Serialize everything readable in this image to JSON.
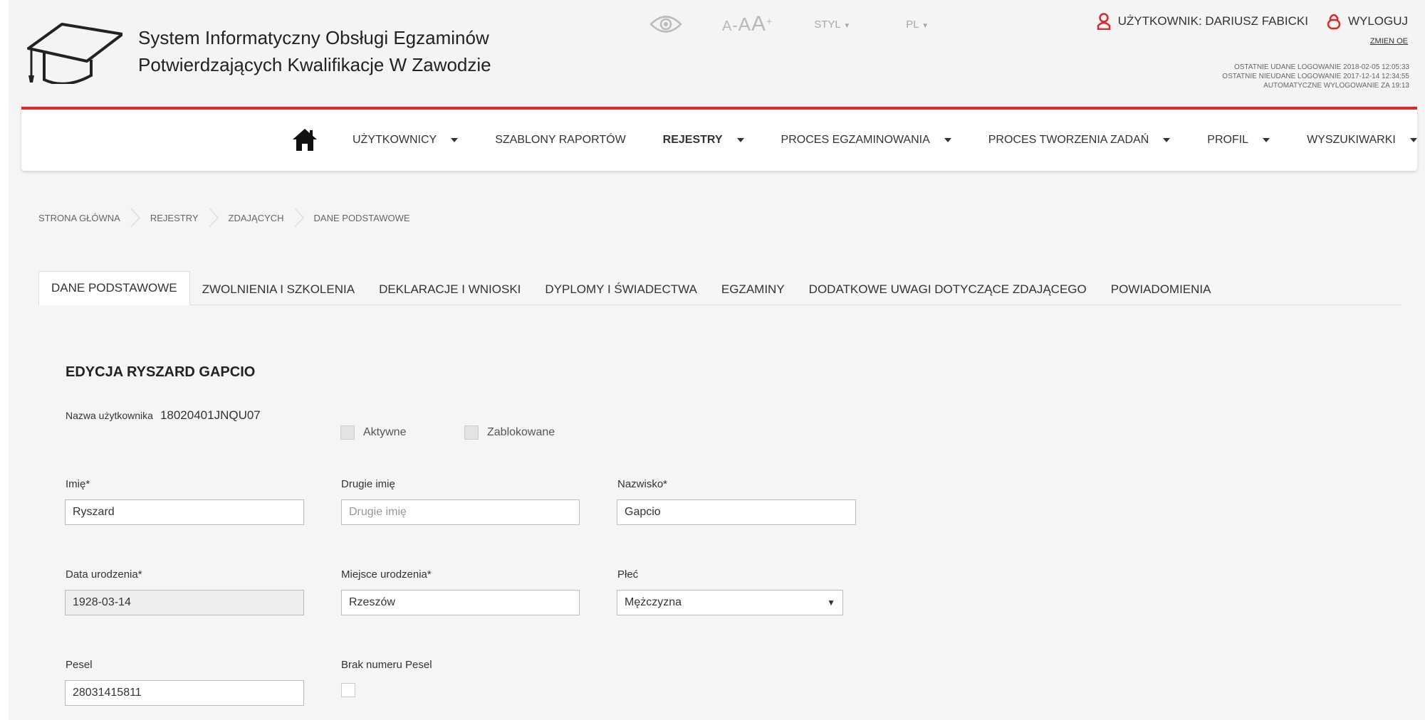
{
  "header": {
    "title_line1": "System Informatyczny Obsługi Egzaminów",
    "title_line2": "Potwierdzających Kwalifikacje W Zawodzie",
    "font_size_a": "A",
    "font_size_sep": "-",
    "font_size_aa": "A",
    "font_size_aaa": "A",
    "font_size_plus": "+",
    "style_label": "STYL",
    "lang_label": "PL",
    "user_label": "UŻYTKOWNIK: DARIUSZ FABICKI",
    "logout_label": "WYLOGUJ",
    "change_password": "ZMIEN OE",
    "last_success": "OSTATNIE UDANE LOGOWANIE 2018-02-05 12:05:33",
    "last_failed": "OSTATNIE NIEUDANE LOGOWANIE 2017-12-14 12:34:55",
    "auto_logout": "AUTOMATYCZNE WYLOGOWANIE ZA  19:13",
    "accent_color": "#e0262b"
  },
  "nav": {
    "items": [
      {
        "label": "UŻYTKOWNICY",
        "dropdown": true
      },
      {
        "label": "SZABLONY RAPORTÓW",
        "dropdown": false
      },
      {
        "label": "REJESTRY",
        "dropdown": true,
        "active": true
      },
      {
        "label": "PROCES EGZAMINOWANIA",
        "dropdown": true
      },
      {
        "label": "PROCES TWORZENIA ZADAŃ",
        "dropdown": true
      },
      {
        "label": "PROFIL",
        "dropdown": true
      },
      {
        "label": "WYSZUKIWARKI",
        "dropdown": true
      }
    ]
  },
  "breadcrumb": [
    "STRONA GŁÓWNA",
    "REJESTRY",
    "ZDAJĄCYCH",
    "DANE PODSTAWOWE"
  ],
  "tabs": [
    {
      "label": "DANE PODSTAWOWE",
      "active": true
    },
    {
      "label": "ZWOLNIENIA I SZKOLENIA"
    },
    {
      "label": "DEKLARACJE I WNIOSKI"
    },
    {
      "label": "DYPLOMY I ŚWIADECTWA"
    },
    {
      "label": "EGZAMINY"
    },
    {
      "label": "DODATKOWE UWAGI DOTYCZĄCE ZDAJĄCEGO"
    },
    {
      "label": "POWIADOMIENIA"
    }
  ],
  "form": {
    "title": "EDYCJA RYSZARD GAPCIO",
    "username_label": "Nazwa użytkownika",
    "username_value": "18020401JNQU07",
    "active_label": "Aktywne",
    "blocked_label": "Zablokowane",
    "first_name_label": "Imię*",
    "first_name_value": "Ryszard",
    "second_name_label": "Drugie imię",
    "second_name_placeholder": "Drugie imię",
    "surname_label": "Nazwisko*",
    "surname_value": "Gapcio",
    "birth_date_label": "Data urodzenia*",
    "birth_date_value": "1928-03-14",
    "birth_place_label": "Miejsce urodzenia*",
    "birth_place_value": "Rzeszów",
    "gender_label": "Płeć",
    "gender_value": "Mężczyzna",
    "pesel_label": "Pesel",
    "pesel_value": "28031415811",
    "no_pesel_label": "Brak numeru Pesel"
  }
}
